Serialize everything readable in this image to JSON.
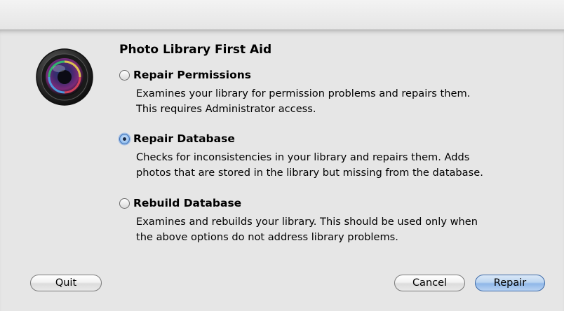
{
  "dialog": {
    "title": "Photo Library First Aid",
    "app_icon": "aperture-camera-lens-icon"
  },
  "options": [
    {
      "label": "Repair Permissions",
      "desc_line1": "Examines your library for permission problems and repairs them.",
      "desc_line2": "This requires Administrator access.",
      "selected": false
    },
    {
      "label": "Repair Database",
      "desc_line1": "Checks for inconsistencies in your library and repairs them. Adds",
      "desc_line2": "photos that are stored in the library but missing from the database.",
      "selected": true
    },
    {
      "label": "Rebuild Database",
      "desc_line1": "Examines and rebuilds your library. This should be used only when",
      "desc_line2": "the above options do not address library problems.",
      "selected": false
    }
  ],
  "buttons": {
    "quit": "Quit",
    "cancel": "Cancel",
    "repair": "Repair"
  },
  "colors": {
    "default_button": "#8fb7e8",
    "selected_radio": "#5d94d8"
  }
}
